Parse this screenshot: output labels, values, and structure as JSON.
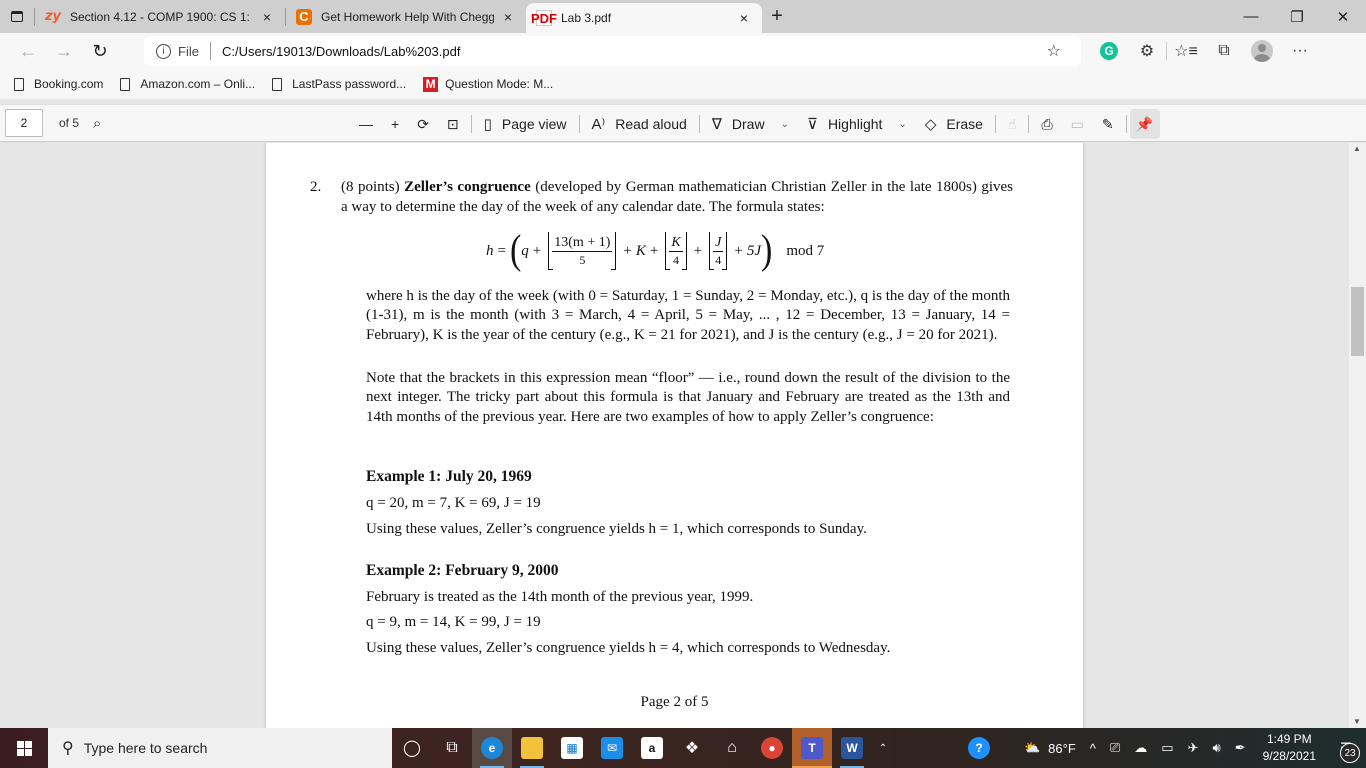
{
  "browser": {
    "tabs": [
      {
        "favicon": "zy",
        "title": "Section 4.12 - COMP 1900: CS 1:",
        "close": "×"
      },
      {
        "favicon": "C",
        "title": "Get Homework Help With Chegg",
        "close": "×"
      },
      {
        "favicon": "PDF",
        "title": "Lab 3.pdf",
        "close": "×",
        "active": true
      }
    ],
    "new_tab": "+",
    "window_controls": {
      "minimize": "—",
      "restore": "❐",
      "close": "✕"
    },
    "nav": {
      "back": "←",
      "forward": "→",
      "refresh": "↻"
    },
    "address": {
      "info": "i",
      "scheme": "File",
      "url": "C:/Users/19013/Downloads/Lab%203.pdf"
    },
    "toolbar_icons": {
      "add_favorite": "☆",
      "grammarly": "G",
      "extensions": "⚙",
      "favorites": "☆≡",
      "collections": "⧉",
      "more": "···"
    },
    "bookmarks": [
      {
        "label": "Booking.com",
        "icon": "page-icon"
      },
      {
        "label": "Amazon.com – Onli...",
        "icon": "page-icon"
      },
      {
        "label": "LastPass password...",
        "icon": "page-icon"
      },
      {
        "label": "Question Mode: M...",
        "icon": "M"
      }
    ]
  },
  "pdf_toolbar": {
    "page_number": "2",
    "of_pages": "of 5",
    "search_icon": "⌕",
    "zoom_out": "—",
    "zoom_in": "+",
    "rotate": "⟳",
    "fit": "⊡",
    "page_view": "Page view",
    "read_aloud": "Read aloud",
    "draw": "Draw",
    "highlight": "Highlight",
    "erase": "Erase",
    "chevron": "⌄"
  },
  "document": {
    "question_number": "2.",
    "points": "(8 points)",
    "term": "Zeller’s congruence",
    "intro_rest": "(developed by German mathematician Christian Zeller in the late 1800s) gives a way to determine the day of the week of any calendar date. The formula states:",
    "formula": {
      "lhs": "h",
      "eq": "=",
      "q": "q",
      "frac1_num": "13(m + 1)",
      "frac1_den": "5",
      "K": "K",
      "frac2_num": "K",
      "frac2_den": "4",
      "frac3_num": "J",
      "frac3_den": "4",
      "last": "5J",
      "mod": "mod 7"
    },
    "para1": "where h is the day of the week (with 0 = Saturday, 1 = Sunday, 2 = Monday, etc.), q is the day of the month (1-31), m is the month (with 3 = March, 4 = April, 5 = May, ... , 12 = December, 13 = January, 14 = February), K is the year of the century (e.g., K = 21 for 2021), and J is the century (e.g., J = 20 for 2021).",
    "para2": "Note that the brackets in this expression mean “floor” — i.e., round down the result of the division to the next integer. The tricky part about this formula is that January and February are treated as the 13th and 14th months of the previous year. Here are two examples of how to apply Zeller’s congruence:",
    "example1": {
      "heading": "Example 1: July 20, 1969",
      "values": "q = 20, m = 7, K = 69, J = 19",
      "result": "Using these values, Zeller’s congruence yields h = 1, which corresponds to Sunday."
    },
    "example2": {
      "heading": "Example 2: February 9, 2000",
      "note": "February is treated as the 14th month of the previous year, 1999.",
      "values": "q = 9, m = 14, K = 99, J = 19",
      "result": "Using these values, Zeller’s congruence yields h = 4, which corresponds to Wednesday."
    },
    "footer": "Page 2 of 5"
  },
  "scroll": {
    "position_fraction": 0.27
  },
  "taskbar": {
    "search_placeholder": "Type here to search",
    "weather": "86°F",
    "time": "1:49 PM",
    "date": "9/28/2021",
    "notifications": "23"
  }
}
